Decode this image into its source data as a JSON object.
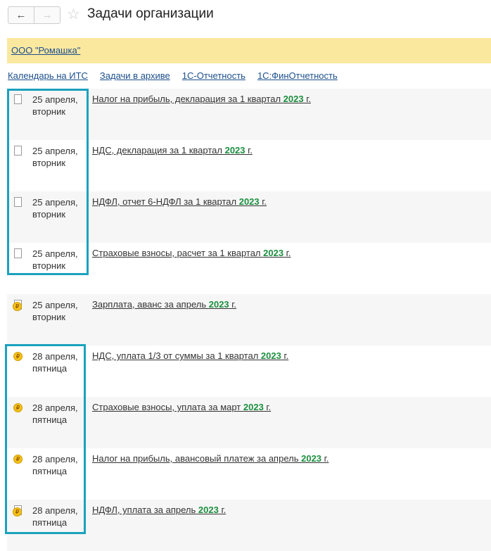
{
  "header": {
    "title": "Задачи организации",
    "back": "←",
    "forward": "→",
    "star": "☆"
  },
  "organization": "ООО \"Ромашка\"",
  "links": [
    "Календарь на ИТС",
    "Задачи в архиве",
    "1С-Отчетность",
    "1С:ФинОтчетность"
  ],
  "colors": {
    "highlight": "#1aa2be",
    "year": "#1b8f3e",
    "org_bar": "#fbe89f"
  },
  "tasks": [
    {
      "icon": "document-icon",
      "date1": "25 апреля,",
      "date2": "вторник",
      "text": "Налог на прибыль, декларация за 1 квартал ",
      "year": "2023",
      "suffix": " г."
    },
    {
      "icon": "document-icon",
      "date1": "25 апреля,",
      "date2": "вторник",
      "text": "НДС, декларация за 1 квартал ",
      "year": "2023",
      "suffix": " г."
    },
    {
      "icon": "document-icon",
      "date1": "25 апреля,",
      "date2": "вторник",
      "text": "НДФЛ, отчет 6-НДФЛ за 1 квартал ",
      "year": "2023",
      "suffix": " г."
    },
    {
      "icon": "document-icon",
      "date1": "25 апреля,",
      "date2": "вторник",
      "text": "Страховые взносы, расчет за 1 квартал ",
      "year": "2023",
      "suffix": " г."
    },
    {
      "icon": "document-ruble-icon",
      "date1": "25 апреля,",
      "date2": "вторник",
      "text": "Зарплата, аванс за апрель ",
      "year": "2023",
      "suffix": " г."
    },
    {
      "icon": "ruble-coin-icon",
      "date1": "28 апреля,",
      "date2": "пятница",
      "text": "НДС, уплата 1/3 от суммы за 1 квартал ",
      "year": "2023",
      "suffix": " г."
    },
    {
      "icon": "ruble-coin-icon",
      "date1": "28 апреля,",
      "date2": "пятница",
      "text": "Страховые взносы, уплата за март ",
      "year": "2023",
      "suffix": " г."
    },
    {
      "icon": "ruble-coin-icon",
      "date1": "28 апреля,",
      "date2": "пятница",
      "text": "Налог на прибыль, авансовый платеж за апрель ",
      "year": "2023",
      "suffix": " г."
    },
    {
      "icon": "document-ruble-icon",
      "date1": "28 апреля,",
      "date2": "пятница",
      "text": "НДФЛ, уплата за апрель ",
      "year": "2023",
      "suffix": " г."
    }
  ]
}
